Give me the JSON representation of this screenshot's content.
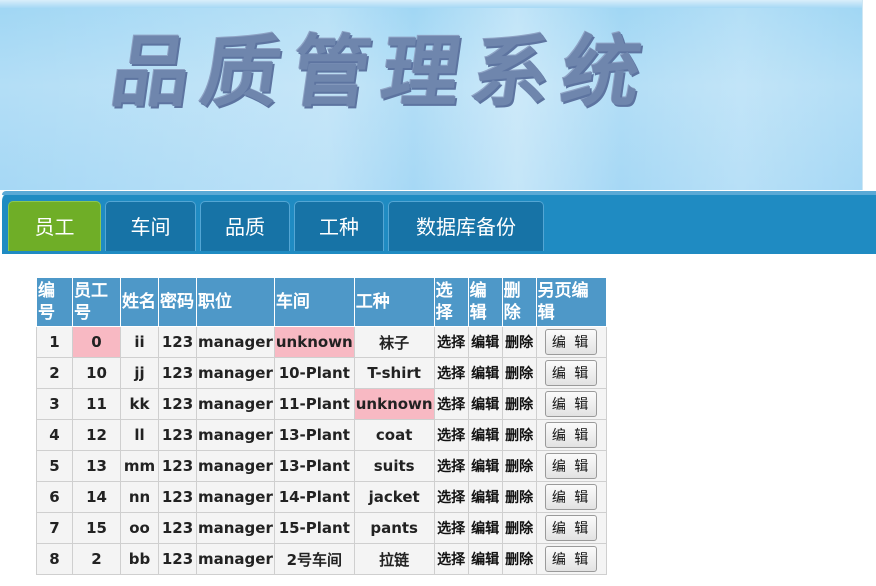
{
  "banner": {
    "title": "品质管理系统"
  },
  "tabs": [
    {
      "label": "员工",
      "active": true
    },
    {
      "label": "车间",
      "active": false
    },
    {
      "label": "品质",
      "active": false
    },
    {
      "label": "工种",
      "active": false
    },
    {
      "label": "数据库备份",
      "active": false
    }
  ],
  "table": {
    "headers": [
      "编号",
      "员工号",
      "姓名",
      "密码",
      "职位",
      "车间",
      "工种",
      "选择",
      "编辑",
      "删除",
      "另页编辑"
    ],
    "rows": [
      {
        "no": "1",
        "emp_id": "0",
        "name": "ii",
        "pwd": "123",
        "position": "manager",
        "workshop": "unknown",
        "worktype": "袜子",
        "select": "选择",
        "edit": "编辑",
        "delete": "删除",
        "page_edit": "编 辑"
      },
      {
        "no": "2",
        "emp_id": "10",
        "name": "jj",
        "pwd": "123",
        "position": "manager",
        "workshop": "10-Plant",
        "worktype": "T-shirt",
        "select": "选择",
        "edit": "编辑",
        "delete": "删除",
        "page_edit": "编 辑"
      },
      {
        "no": "3",
        "emp_id": "11",
        "name": "kk",
        "pwd": "123",
        "position": "manager",
        "workshop": "11-Plant",
        "worktype": "unknown",
        "select": "选择",
        "edit": "编辑",
        "delete": "删除",
        "page_edit": "编 辑"
      },
      {
        "no": "4",
        "emp_id": "12",
        "name": "ll",
        "pwd": "123",
        "position": "manager",
        "workshop": "13-Plant",
        "worktype": "coat",
        "select": "选择",
        "edit": "编辑",
        "delete": "删除",
        "page_edit": "编 辑"
      },
      {
        "no": "5",
        "emp_id": "13",
        "name": "mm",
        "pwd": "123",
        "position": "manager",
        "workshop": "13-Plant",
        "worktype": "suits",
        "select": "选择",
        "edit": "编辑",
        "delete": "删除",
        "page_edit": "编 辑"
      },
      {
        "no": "6",
        "emp_id": "14",
        "name": "nn",
        "pwd": "123",
        "position": "manager",
        "workshop": "14-Plant",
        "worktype": "jacket",
        "select": "选择",
        "edit": "编辑",
        "delete": "删除",
        "page_edit": "编 辑"
      },
      {
        "no": "7",
        "emp_id": "15",
        "name": "oo",
        "pwd": "123",
        "position": "manager",
        "workshop": "15-Plant",
        "worktype": "pants",
        "select": "选择",
        "edit": "编辑",
        "delete": "删除",
        "page_edit": "编 辑"
      },
      {
        "no": "8",
        "emp_id": "2",
        "name": "bb",
        "pwd": "123",
        "position": "manager",
        "workshop": "2号车间",
        "worktype": "拉链",
        "select": "选择",
        "edit": "编辑",
        "delete": "删除",
        "page_edit": "编 辑"
      }
    ]
  },
  "colors": {
    "tab_bar": "#1f8bc2",
    "tab": "#1773a6",
    "tab_active": "#6fae27",
    "header_cell": "#4e98c8",
    "highlight_unknown": "#f8b9c3"
  }
}
